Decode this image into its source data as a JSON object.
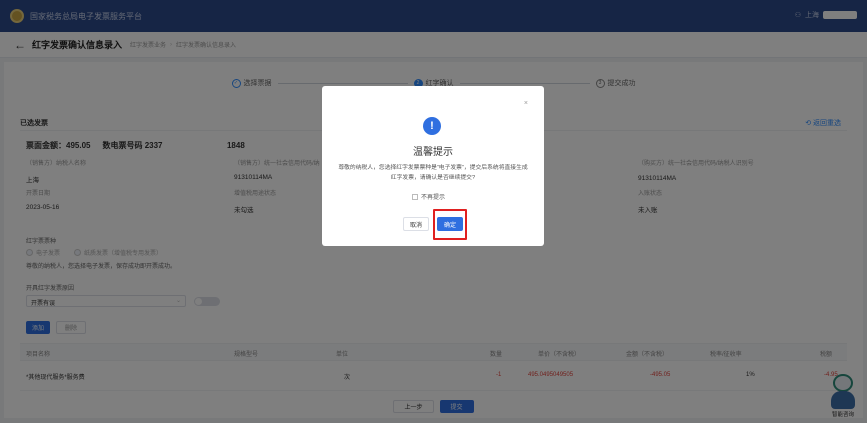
{
  "topbar": {
    "title": "国家税务总局电子发票服务平台",
    "user_prefix": "上海"
  },
  "header": {
    "page_title": "红字发票确认信息录入",
    "crumbs": [
      "红字发票业务",
      "红字发票确认信息录入"
    ]
  },
  "steps": [
    {
      "index": "1",
      "label": "选择票据",
      "state": "done"
    },
    {
      "index": "2",
      "label": "红字确认",
      "state": "active"
    },
    {
      "index": "3",
      "label": "提交成功",
      "state": "todo"
    }
  ],
  "invoice": {
    "section_title": "已选发票",
    "return_link": "返回重选",
    "amount_label": "票面金额：495.05",
    "number_label": "数电票号码 2337",
    "number_tail": "1848",
    "fields": [
      {
        "label": "（销售方）纳税人名称",
        "value": "上海"
      },
      {
        "label": "（销售方）统一社会信用代码/纳",
        "value": "91310114MA"
      },
      {
        "label": "（购买方）统一社会信用代码/纳税人识别号",
        "value": "91310114MA"
      },
      {
        "label": "开票日期",
        "value": "2023-05-16"
      },
      {
        "label": "增值税用途状态",
        "value": "未勾选"
      },
      {
        "label": "入账状态",
        "value": "未入账"
      }
    ]
  },
  "red_type": {
    "label": "红字票票种",
    "options": [
      "电子发票",
      "纸质发票（增值税专用发票）"
    ],
    "tip": "尊敬的纳税人，您选择电子发票，保存成功即开票成功。"
  },
  "reason": {
    "label": "开具红字发票原因",
    "value": "开票有误"
  },
  "actions": {
    "add": "添加",
    "delete": "删除"
  },
  "table": {
    "headers": [
      "项目名称",
      "规格型号",
      "单位",
      "数量",
      "单价（不含税）",
      "金额（不含税）",
      "税率/征收率",
      "税额"
    ],
    "rows": [
      [
        "*其他现代服务*服务费",
        "",
        "次",
        "-1",
        "495.0495049505",
        "-495.05",
        "1%",
        "-4.95"
      ]
    ]
  },
  "footer": {
    "prev": "上一步",
    "submit": "提交"
  },
  "robot": {
    "label": "智能咨询"
  },
  "dialog": {
    "close": "×",
    "icon": "!",
    "title": "温馨提示",
    "message": "尊敬的纳税人，您选择红字发票票种是“电子发票”，提交后系统将直接生成红字发票，请确认是否继续提交?",
    "checkbox_label": "不再提示",
    "cancel": "取消",
    "confirm": "确定"
  },
  "colors": {
    "primary": "#2f6fe0",
    "header": "#2d4a8a",
    "highlight": "#e02020"
  }
}
